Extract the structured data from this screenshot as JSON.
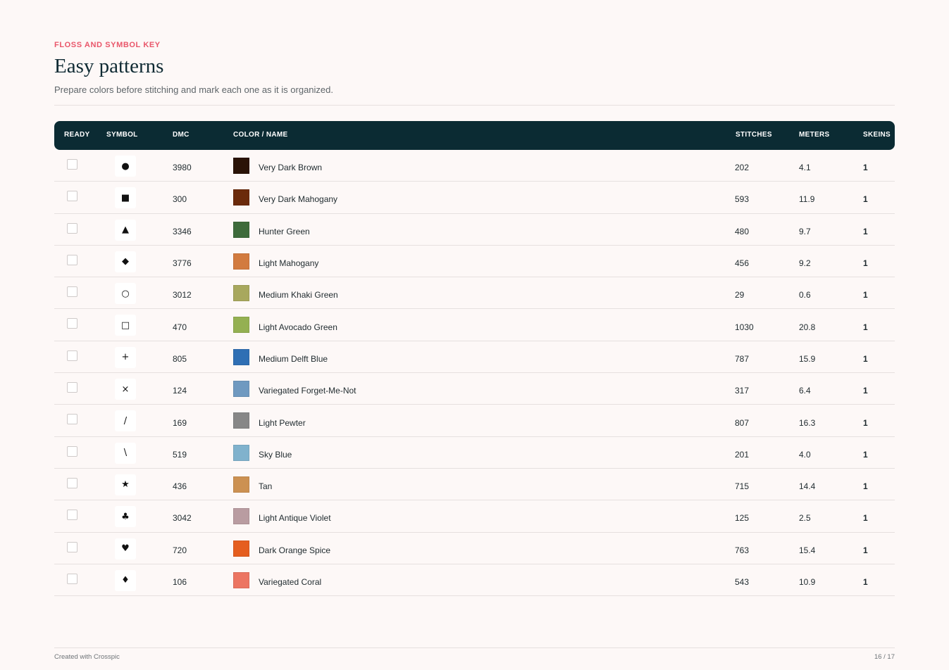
{
  "header": {
    "eyebrow": "FLOSS AND SYMBOL KEY",
    "title": "Easy patterns",
    "subtitle": "Prepare colors before stitching and mark each one as it is organized."
  },
  "table": {
    "columns": {
      "ready": "READY",
      "symbol": "SYMBOL",
      "dmc": "DMC",
      "name": "COLOR / NAME",
      "stitches": "STITCHES",
      "meters": "METERS",
      "skeins": "SKEINS"
    },
    "rows": [
      {
        "symbol": "●",
        "symbol_name": "filled-circle-icon",
        "dmc": "3980",
        "color": "#2a1307",
        "name": "Very Dark Brown",
        "stitches": "202",
        "meters": "4.1",
        "skeins": "1"
      },
      {
        "symbol": "■",
        "symbol_name": "filled-square-icon",
        "dmc": "300",
        "color": "#6b2a0b",
        "name": "Very Dark Mahogany",
        "stitches": "593",
        "meters": "11.9",
        "skeins": "1"
      },
      {
        "symbol": "▲",
        "symbol_name": "filled-triangle-icon",
        "dmc": "3346",
        "color": "#3d6b3b",
        "name": "Hunter Green",
        "stitches": "480",
        "meters": "9.7",
        "skeins": "1"
      },
      {
        "symbol": "◆",
        "symbol_name": "filled-diamond-icon",
        "dmc": "3776",
        "color": "#d27b3f",
        "name": "Light Mahogany",
        "stitches": "456",
        "meters": "9.2",
        "skeins": "1"
      },
      {
        "symbol": "○",
        "symbol_name": "hollow-circle-icon",
        "dmc": "3012",
        "color": "#a8a85e",
        "name": "Medium Khaki Green",
        "stitches": "29",
        "meters": "0.6",
        "skeins": "1"
      },
      {
        "symbol": "□",
        "symbol_name": "hollow-square-icon",
        "dmc": "470",
        "color": "#94b052",
        "name": "Light Avocado Green",
        "stitches": "1030",
        "meters": "20.8",
        "skeins": "1"
      },
      {
        "symbol": "+",
        "symbol_name": "plus-icon",
        "dmc": "805",
        "color": "#2f6fb4",
        "name": "Medium Delft Blue",
        "stitches": "787",
        "meters": "15.9",
        "skeins": "1"
      },
      {
        "symbol": "×",
        "symbol_name": "cross-icon",
        "dmc": "124",
        "color": "#6f99c0",
        "name": "Variegated Forget-Me-Not",
        "stitches": "317",
        "meters": "6.4",
        "skeins": "1"
      },
      {
        "symbol": "/",
        "symbol_name": "slash-icon",
        "dmc": "169",
        "color": "#878787",
        "name": "Light Pewter",
        "stitches": "807",
        "meters": "16.3",
        "skeins": "1"
      },
      {
        "symbol": "\\",
        "symbol_name": "backslash-icon",
        "dmc": "519",
        "color": "#80b2cd",
        "name": "Sky Blue",
        "stitches": "201",
        "meters": "4.0",
        "skeins": "1"
      },
      {
        "symbol": "★",
        "symbol_name": "star-icon",
        "dmc": "436",
        "color": "#cc9152",
        "name": "Tan",
        "stitches": "715",
        "meters": "14.4",
        "skeins": "1"
      },
      {
        "symbol": "♣",
        "symbol_name": "club-icon",
        "dmc": "3042",
        "color": "#b99ca1",
        "name": "Light Antique Violet",
        "stitches": "125",
        "meters": "2.5",
        "skeins": "1"
      },
      {
        "symbol": "♥",
        "symbol_name": "heart-icon",
        "dmc": "720",
        "color": "#e55e1f",
        "name": "Dark Orange Spice",
        "stitches": "763",
        "meters": "15.4",
        "skeins": "1"
      },
      {
        "symbol": "♦",
        "symbol_name": "small-diamond-icon",
        "dmc": "106",
        "color": "#ec7562",
        "name": "Variegated Coral",
        "stitches": "543",
        "meters": "10.9",
        "skeins": "1"
      }
    ]
  },
  "footer": {
    "credit": "Created with Crosspic",
    "page": "16 / 17"
  }
}
